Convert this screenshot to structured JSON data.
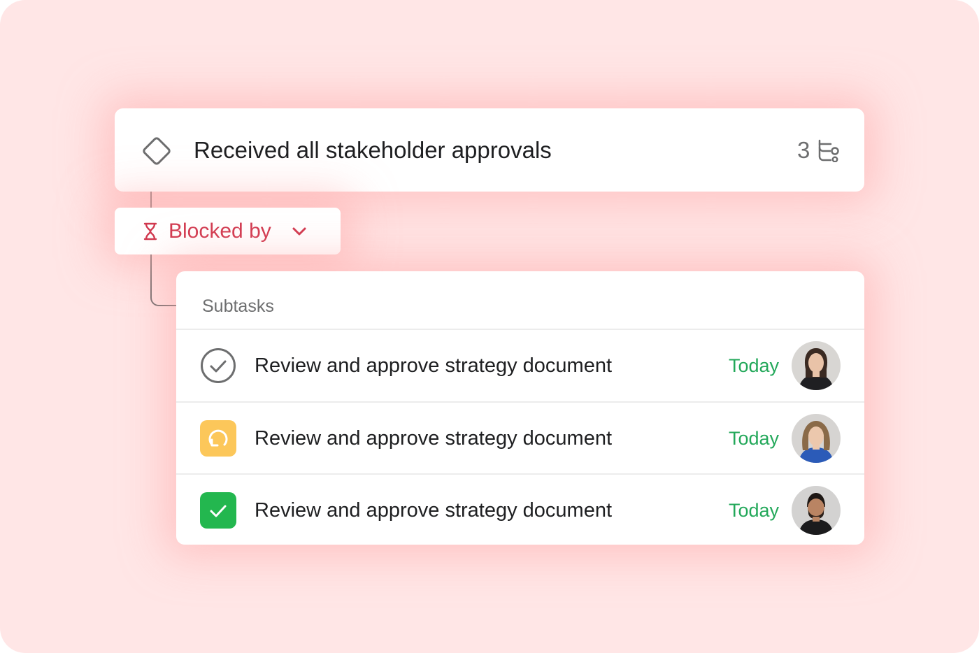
{
  "milestone": {
    "title": "Received all stakeholder approvals",
    "subtask_count": "3",
    "icon": "diamond-milestone-icon",
    "subtasks_icon": "subtasks-icon"
  },
  "dependency": {
    "label": "Blocked by",
    "icon": "hourglass-icon",
    "color": "#d1394f"
  },
  "subtasks": {
    "header": "Subtasks",
    "rows": [
      {
        "name": "Review and approve strategy document",
        "due": "Today",
        "status": "not-started",
        "status_icon": "check-circle-outline-icon"
      },
      {
        "name": "Review and approve strategy document",
        "due": "Today",
        "status": "in-progress",
        "status_icon": "refresh-icon",
        "status_color": "#fcc75a"
      },
      {
        "name": "Review and approve strategy document",
        "due": "Today",
        "status": "completed",
        "status_icon": "check-icon",
        "status_color": "#23b74f"
      }
    ]
  },
  "colors": {
    "background": "#ffe6e6",
    "due_date": "#23a85a",
    "text_primary": "#1e1f21",
    "text_secondary": "#6d6e6f"
  }
}
